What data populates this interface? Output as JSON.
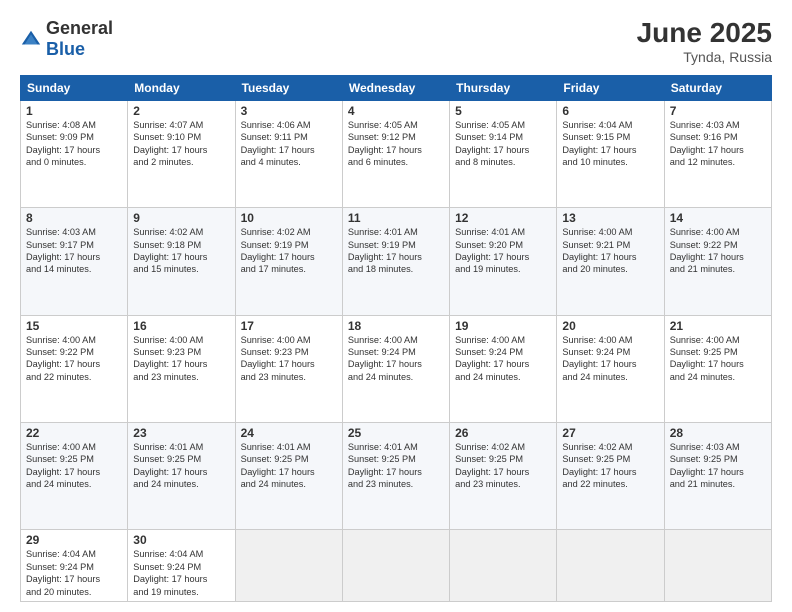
{
  "logo": {
    "general": "General",
    "blue": "Blue"
  },
  "title": {
    "month_year": "June 2025",
    "location": "Tynda, Russia"
  },
  "headers": [
    "Sunday",
    "Monday",
    "Tuesday",
    "Wednesday",
    "Thursday",
    "Friday",
    "Saturday"
  ],
  "weeks": [
    [
      {
        "num": "1",
        "info": "Sunrise: 4:08 AM\nSunset: 9:09 PM\nDaylight: 17 hours\nand 0 minutes."
      },
      {
        "num": "2",
        "info": "Sunrise: 4:07 AM\nSunset: 9:10 PM\nDaylight: 17 hours\nand 2 minutes."
      },
      {
        "num": "3",
        "info": "Sunrise: 4:06 AM\nSunset: 9:11 PM\nDaylight: 17 hours\nand 4 minutes."
      },
      {
        "num": "4",
        "info": "Sunrise: 4:05 AM\nSunset: 9:12 PM\nDaylight: 17 hours\nand 6 minutes."
      },
      {
        "num": "5",
        "info": "Sunrise: 4:05 AM\nSunset: 9:14 PM\nDaylight: 17 hours\nand 8 minutes."
      },
      {
        "num": "6",
        "info": "Sunrise: 4:04 AM\nSunset: 9:15 PM\nDaylight: 17 hours\nand 10 minutes."
      },
      {
        "num": "7",
        "info": "Sunrise: 4:03 AM\nSunset: 9:16 PM\nDaylight: 17 hours\nand 12 minutes."
      }
    ],
    [
      {
        "num": "8",
        "info": "Sunrise: 4:03 AM\nSunset: 9:17 PM\nDaylight: 17 hours\nand 14 minutes."
      },
      {
        "num": "9",
        "info": "Sunrise: 4:02 AM\nSunset: 9:18 PM\nDaylight: 17 hours\nand 15 minutes."
      },
      {
        "num": "10",
        "info": "Sunrise: 4:02 AM\nSunset: 9:19 PM\nDaylight: 17 hours\nand 17 minutes."
      },
      {
        "num": "11",
        "info": "Sunrise: 4:01 AM\nSunset: 9:19 PM\nDaylight: 17 hours\nand 18 minutes."
      },
      {
        "num": "12",
        "info": "Sunrise: 4:01 AM\nSunset: 9:20 PM\nDaylight: 17 hours\nand 19 minutes."
      },
      {
        "num": "13",
        "info": "Sunrise: 4:00 AM\nSunset: 9:21 PM\nDaylight: 17 hours\nand 20 minutes."
      },
      {
        "num": "14",
        "info": "Sunrise: 4:00 AM\nSunset: 9:22 PM\nDaylight: 17 hours\nand 21 minutes."
      }
    ],
    [
      {
        "num": "15",
        "info": "Sunrise: 4:00 AM\nSunset: 9:22 PM\nDaylight: 17 hours\nand 22 minutes."
      },
      {
        "num": "16",
        "info": "Sunrise: 4:00 AM\nSunset: 9:23 PM\nDaylight: 17 hours\nand 23 minutes."
      },
      {
        "num": "17",
        "info": "Sunrise: 4:00 AM\nSunset: 9:23 PM\nDaylight: 17 hours\nand 23 minutes."
      },
      {
        "num": "18",
        "info": "Sunrise: 4:00 AM\nSunset: 9:24 PM\nDaylight: 17 hours\nand 24 minutes."
      },
      {
        "num": "19",
        "info": "Sunrise: 4:00 AM\nSunset: 9:24 PM\nDaylight: 17 hours\nand 24 minutes."
      },
      {
        "num": "20",
        "info": "Sunrise: 4:00 AM\nSunset: 9:24 PM\nDaylight: 17 hours\nand 24 minutes."
      },
      {
        "num": "21",
        "info": "Sunrise: 4:00 AM\nSunset: 9:25 PM\nDaylight: 17 hours\nand 24 minutes."
      }
    ],
    [
      {
        "num": "22",
        "info": "Sunrise: 4:00 AM\nSunset: 9:25 PM\nDaylight: 17 hours\nand 24 minutes."
      },
      {
        "num": "23",
        "info": "Sunrise: 4:01 AM\nSunset: 9:25 PM\nDaylight: 17 hours\nand 24 minutes."
      },
      {
        "num": "24",
        "info": "Sunrise: 4:01 AM\nSunset: 9:25 PM\nDaylight: 17 hours\nand 24 minutes."
      },
      {
        "num": "25",
        "info": "Sunrise: 4:01 AM\nSunset: 9:25 PM\nDaylight: 17 hours\nand 23 minutes."
      },
      {
        "num": "26",
        "info": "Sunrise: 4:02 AM\nSunset: 9:25 PM\nDaylight: 17 hours\nand 23 minutes."
      },
      {
        "num": "27",
        "info": "Sunrise: 4:02 AM\nSunset: 9:25 PM\nDaylight: 17 hours\nand 22 minutes."
      },
      {
        "num": "28",
        "info": "Sunrise: 4:03 AM\nSunset: 9:25 PM\nDaylight: 17 hours\nand 21 minutes."
      }
    ],
    [
      {
        "num": "29",
        "info": "Sunrise: 4:04 AM\nSunset: 9:24 PM\nDaylight: 17 hours\nand 20 minutes."
      },
      {
        "num": "30",
        "info": "Sunrise: 4:04 AM\nSunset: 9:24 PM\nDaylight: 17 hours\nand 19 minutes."
      },
      {
        "num": "",
        "info": ""
      },
      {
        "num": "",
        "info": ""
      },
      {
        "num": "",
        "info": ""
      },
      {
        "num": "",
        "info": ""
      },
      {
        "num": "",
        "info": ""
      }
    ]
  ]
}
